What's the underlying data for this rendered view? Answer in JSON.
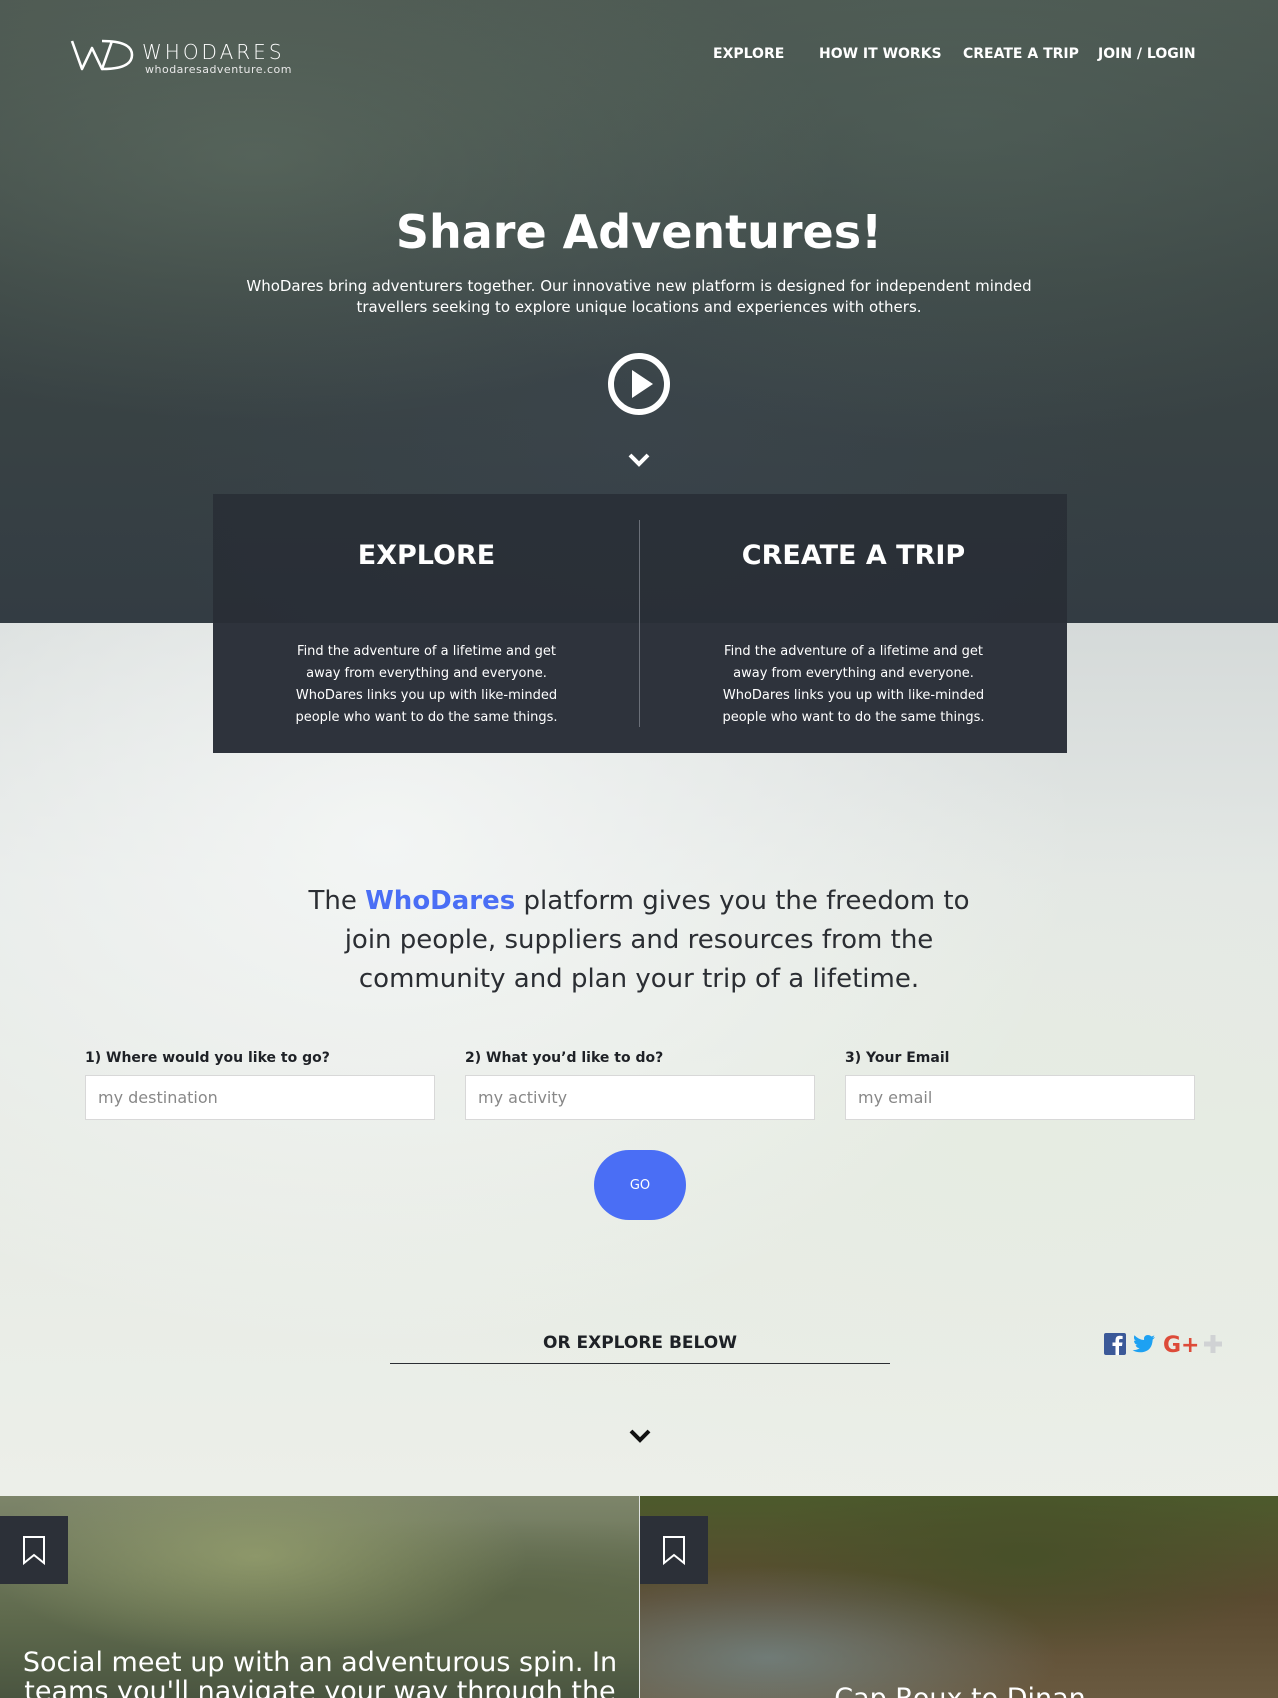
{
  "brand": {
    "name": "WHODARES",
    "url": "whodaresadventure.com"
  },
  "nav": {
    "explore": "EXPLORE",
    "how_it_works": "HOW IT WORKS",
    "create_trip": "CREATE A TRIP",
    "join_login": "JOIN / LOGIN"
  },
  "hero": {
    "title": "Share Adventures!",
    "text": "WhoDares bring adventurers together. Our innovative new platform is designed for independent minded travellers seeking to explore unique locations and experiences with others."
  },
  "cards": [
    {
      "title": "EXPLORE",
      "text": "Find the adventure of a lifetime and get away from everything and everyone. WhoDares links you up with like-minded people who want to do the same things."
    },
    {
      "title": "CREATE A TRIP",
      "text": "Find the adventure of a lifetime and get away from everything and everyone. WhoDares links you up with like-minded people who want to do the same things."
    }
  ],
  "intro": {
    "before": "The ",
    "brand": "WhoDares",
    "after": " platform gives you the freedom to join people, suppliers and resources from the community and plan your trip of a lifetime."
  },
  "form": {
    "destination_label": "1) Where would you like to go?",
    "destination_placeholder": "my destination",
    "activity_label": "2) What you’d like to do?",
    "activity_placeholder": "my activity",
    "email_label": "3) Your Email",
    "email_placeholder": "my email",
    "go_label": "GO"
  },
  "explore_below": "OR EXPLORE BELOW",
  "social": [
    "facebook-icon",
    "twitter-icon",
    "google-plus-icon",
    "share-icon"
  ],
  "tiles": [
    {
      "text": "Social meet up with an adventurous spin. In teams you'll navigate your way through the"
    },
    {
      "text": "Cap Roux to Dinan"
    }
  ],
  "colors": {
    "accent": "#4a6ef5",
    "card_bg": "#2e333c"
  }
}
